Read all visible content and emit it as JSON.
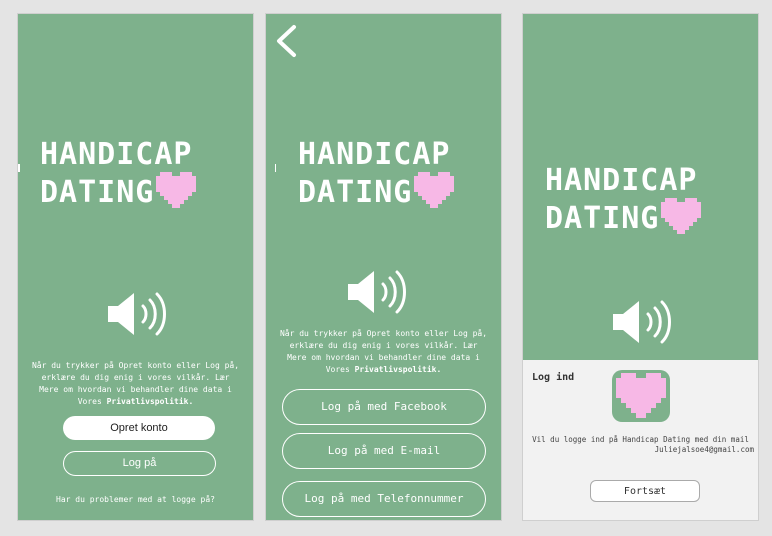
{
  "colors": {
    "background": "#e4e4e4",
    "screen": "#7eb18c",
    "heart": "#f7b8e6",
    "sheet": "#f2f2f2"
  },
  "logo": {
    "line1": "HANDICAP",
    "line2": "DATING"
  },
  "icons": {
    "speaker": "speaker-sound-icon",
    "heart": "pixel-heart-icon",
    "back": "chevron-left-icon"
  },
  "screen1": {
    "terms_line1": "Når du trykker på Opret konto eller Log på,",
    "terms_line2": "erklære du dig enig i vores vilkår. Lær",
    "terms_line3": "Mere om hvordan vi behandler dine data i",
    "terms_line4_prefix": "Vores ",
    "terms_link": "Privatlivspolitik.",
    "create_account": "Opret konto",
    "login": "Log på",
    "trouble": "Har du problemer med at logge på?"
  },
  "screen2": {
    "terms_line1": "Når du trykker på Opret konto eller Log på,",
    "terms_line2": "erklære du dig enig i vores vilkår. Lær",
    "terms_line3": "Mere om hvordan vi behandler dine data i",
    "terms_line4_prefix": "Vores ",
    "terms_link": "Privatlivspolitik.",
    "facebook": "Log på med Facebook",
    "email": "Log på med E-mail",
    "phone": "Log på med Telefonnummer"
  },
  "screen3": {
    "sheet_title": "Log ind",
    "message": "Vil du logge ind på Handicap Dating med din mail",
    "email": "Juliejalsoe4@gmail.com",
    "continue": "Fortsæt"
  }
}
